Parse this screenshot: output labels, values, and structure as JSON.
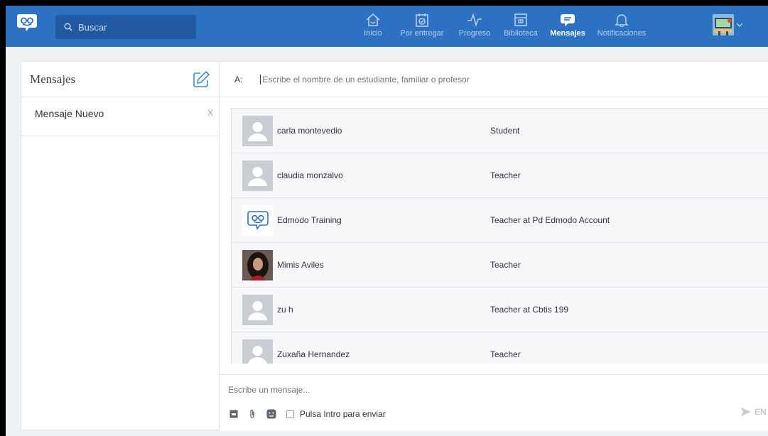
{
  "header": {
    "search_placeholder": "Buscar",
    "nav": [
      {
        "label": "Inicio",
        "icon": "home-icon",
        "active": false
      },
      {
        "label": "Por entregar",
        "icon": "calendar-check-icon",
        "active": false
      },
      {
        "label": "Progreso",
        "icon": "pulse-icon",
        "active": false
      },
      {
        "label": "Biblioteca",
        "icon": "library-icon",
        "active": false
      },
      {
        "label": "Mensajes",
        "icon": "message-icon",
        "active": true
      },
      {
        "label": "Notificaciones",
        "icon": "bell-icon",
        "active": false
      }
    ]
  },
  "sidebar": {
    "title": "Mensajes",
    "threads": [
      {
        "name": "Mensaje Nuevo",
        "close": "X"
      }
    ]
  },
  "compose": {
    "to_label": "A:",
    "to_placeholder": "Escribe el nombre de un estudiante, familiar o profesor",
    "results": [
      {
        "name": "carla montevedio",
        "role": "Student",
        "avatar": "placeholder"
      },
      {
        "name": "claudia monzalvo",
        "role": "Teacher",
        "avatar": "placeholder"
      },
      {
        "name": "Edmodo Training",
        "role": "Teacher at Pd Edmodo Account",
        "avatar": "edmodo-logo"
      },
      {
        "name": "Mimis Aviles",
        "role": "Teacher",
        "avatar": "photo"
      },
      {
        "name": "zu h",
        "role": "Teacher at Cbtis 199",
        "avatar": "placeholder"
      },
      {
        "name": "Zuxaña Hernandez",
        "role": "Teacher",
        "avatar": "placeholder"
      }
    ],
    "message_placeholder": "Escribe un mensaje...",
    "enter_to_send_label": "Pulsa Intro para enviar",
    "send_label": "EN"
  },
  "colors": {
    "topbar": "#2d71c3",
    "accent": "#3b8de0"
  }
}
